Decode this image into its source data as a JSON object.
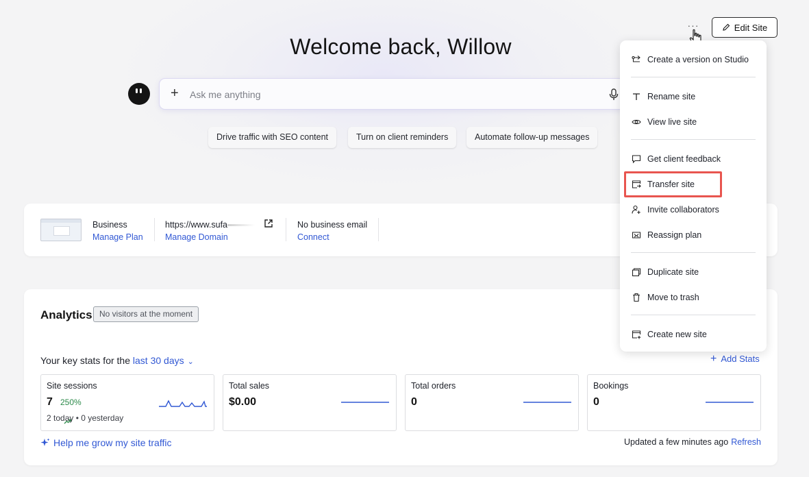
{
  "header": {
    "more_glyph": "···",
    "edit_label": "Edit Site",
    "welcome": "Welcome back, Willow"
  },
  "ask": {
    "plus": "+",
    "placeholder": "Ask me anything"
  },
  "chips": [
    "Drive traffic with SEO content",
    "Turn on client reminders",
    "Automate follow-up messages"
  ],
  "site": {
    "plan_label": "Business",
    "plan_link": "Manage Plan",
    "url": "https://www.sufa",
    "domain_link": "Manage Domain",
    "email_label": "No business email",
    "email_link": "Connect"
  },
  "analytics": {
    "title": "Analytics",
    "badge": "No visitors at the moment",
    "keystats_prefix": "Your key stats for the",
    "range": "last 30 days",
    "add_stats": "Add Stats",
    "stats": [
      {
        "title": "Site sessions",
        "value": "7",
        "change": "250%",
        "sub": "2 today  •  0 yesterday"
      },
      {
        "title": "Total sales",
        "value": "$0.00"
      },
      {
        "title": "Total orders",
        "value": "0"
      },
      {
        "title": "Bookings",
        "value": "0"
      }
    ],
    "grow_link": "Help me grow my site traffic",
    "updated": "Updated a few minutes ago",
    "refresh": "Refresh"
  },
  "menu": {
    "items": [
      {
        "label": "Create a version on Studio",
        "icon": "studio-icon"
      },
      {
        "label": "Rename site",
        "icon": "text-icon"
      },
      {
        "label": "View live site",
        "icon": "eye-icon"
      },
      {
        "label": "Get client feedback",
        "icon": "comment-icon"
      },
      {
        "label": "Transfer site",
        "icon": "transfer-icon"
      },
      {
        "label": "Invite collaborators",
        "icon": "add-person-icon"
      },
      {
        "label": "Reassign plan",
        "icon": "reassign-icon"
      },
      {
        "label": "Duplicate site",
        "icon": "duplicate-icon"
      },
      {
        "label": "Move to trash",
        "icon": "trash-icon"
      },
      {
        "label": "Create new site",
        "icon": "new-site-icon"
      }
    ]
  },
  "colors": {
    "accent": "#3158d4",
    "highlight": "#e8554f",
    "positive": "#2c8a4a"
  }
}
